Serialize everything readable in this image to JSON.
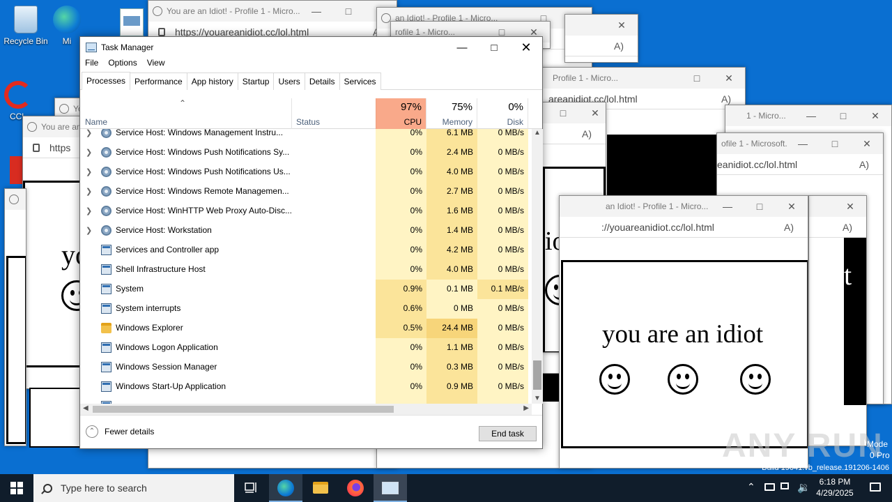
{
  "desktop": {
    "icons": [
      {
        "label": "Recycle Bin"
      },
      {
        "label": "Mi"
      },
      {
        "label": "CCl"
      }
    ],
    "watermark": "ANY RUN",
    "build_text": "Build 19041.vb_release.191206-1406",
    "mode_text": "Mode",
    "pro_text": "0 Pro"
  },
  "edge_windows": {
    "title_full": "You are an Idiot! - Profile 1 - Micro...",
    "title_1": "an Idiot! - Profile 1 - Micro...",
    "title_2": "Profile 1 - Micro...",
    "title_3": "ofile 1 - Microsoft...",
    "title_4": "1 - Micro...",
    "title_5": "rofile 1 - Micro...",
    "title_6": "You are an",
    "title_7": "Yo",
    "url_full": "https://youareanidiot.cc/lol.html",
    "url_1": "areanidiot.cc/lol.html",
    "url_2": "eanidiot.cc/lol.html",
    "url_3": "://youareanidiot.cc/lol.html",
    "url_4": "https",
    "big_text": "you are an idiot",
    "frag_1": "iot",
    "frag_2": "yo",
    "frag_3": "t"
  },
  "task_manager": {
    "title": "Task Manager",
    "menu": [
      "File",
      "Options",
      "View"
    ],
    "tabs": [
      "Processes",
      "Performance",
      "App history",
      "Startup",
      "Users",
      "Details",
      "Services"
    ],
    "columns": {
      "name": "Name",
      "status": "Status",
      "cpu_pct": "97%",
      "cpu": "CPU",
      "mem_pct": "75%",
      "mem": "Memory",
      "disk_pct": "0%",
      "disk": "Disk"
    },
    "rows": [
      {
        "name": "Service Host: Windows Management Instru...",
        "cpu": "0%",
        "mem": "6.1 MB",
        "disk": "0 MB/s"
      },
      {
        "name": "Service Host: Windows Push Notifications Sy...",
        "cpu": "0%",
        "mem": "2.4 MB",
        "disk": "0 MB/s"
      },
      {
        "name": "Service Host: Windows Push Notifications Us...",
        "cpu": "0%",
        "mem": "4.0 MB",
        "disk": "0 MB/s"
      },
      {
        "name": "Service Host: Windows Remote Managemen...",
        "cpu": "0%",
        "mem": "2.7 MB",
        "disk": "0 MB/s"
      },
      {
        "name": "Service Host: WinHTTP Web Proxy Auto-Disc...",
        "cpu": "0%",
        "mem": "1.6 MB",
        "disk": "0 MB/s"
      },
      {
        "name": "Service Host: Workstation",
        "cpu": "0%",
        "mem": "1.4 MB",
        "disk": "0 MB/s"
      },
      {
        "name": "Services and Controller app",
        "cpu": "0%",
        "mem": "4.2 MB",
        "disk": "0 MB/s"
      },
      {
        "name": "Shell Infrastructure Host",
        "cpu": "0%",
        "mem": "4.0 MB",
        "disk": "0 MB/s"
      },
      {
        "name": "System",
        "cpu": "0.9%",
        "mem": "0.1 MB",
        "disk": "0.1 MB/s"
      },
      {
        "name": "System interrupts",
        "cpu": "0.6%",
        "mem": "0 MB",
        "disk": "0 MB/s"
      },
      {
        "name": "Windows Explorer",
        "cpu": "0.5%",
        "mem": "24.4 MB",
        "disk": "0 MB/s"
      },
      {
        "name": "Windows Logon Application",
        "cpu": "0%",
        "mem": "1.1 MB",
        "disk": "0 MB/s"
      },
      {
        "name": "Windows Session Manager",
        "cpu": "0%",
        "mem": "0.3 MB",
        "disk": "0 MB/s"
      },
      {
        "name": "Windows Start-Up Application",
        "cpu": "0%",
        "mem": "0.9 MB",
        "disk": "0 MB/s"
      }
    ],
    "fewer_details": "Fewer details",
    "end_task": "End task"
  },
  "taskbar": {
    "search_placeholder": "Type here to search",
    "time": "6:18 PM",
    "date": "4/29/2025"
  },
  "colors": {
    "desktop_bg": "#0a6fd1",
    "taskbar_bg": "#101d2b",
    "cpu_header_bg": "#f9a98a",
    "heat_light": "#fff4c4",
    "heat_mid": "#fbe49a"
  }
}
